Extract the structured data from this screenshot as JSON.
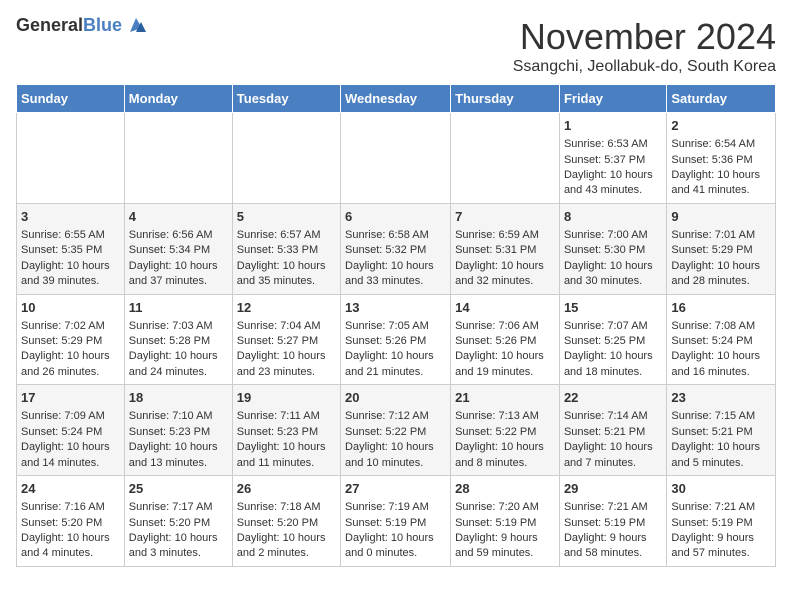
{
  "app": {
    "logo_line1": "General",
    "logo_line2": "Blue"
  },
  "header": {
    "title": "November 2024",
    "subtitle": "Ssangchi, Jeollabuk-do, South Korea"
  },
  "calendar": {
    "days_of_week": [
      "Sunday",
      "Monday",
      "Tuesday",
      "Wednesday",
      "Thursday",
      "Friday",
      "Saturday"
    ],
    "weeks": [
      [
        {
          "day": "",
          "content": ""
        },
        {
          "day": "",
          "content": ""
        },
        {
          "day": "",
          "content": ""
        },
        {
          "day": "",
          "content": ""
        },
        {
          "day": "",
          "content": ""
        },
        {
          "day": "1",
          "content": "Sunrise: 6:53 AM\nSunset: 5:37 PM\nDaylight: 10 hours and 43 minutes."
        },
        {
          "day": "2",
          "content": "Sunrise: 6:54 AM\nSunset: 5:36 PM\nDaylight: 10 hours and 41 minutes."
        }
      ],
      [
        {
          "day": "3",
          "content": "Sunrise: 6:55 AM\nSunset: 5:35 PM\nDaylight: 10 hours and 39 minutes."
        },
        {
          "day": "4",
          "content": "Sunrise: 6:56 AM\nSunset: 5:34 PM\nDaylight: 10 hours and 37 minutes."
        },
        {
          "day": "5",
          "content": "Sunrise: 6:57 AM\nSunset: 5:33 PM\nDaylight: 10 hours and 35 minutes."
        },
        {
          "day": "6",
          "content": "Sunrise: 6:58 AM\nSunset: 5:32 PM\nDaylight: 10 hours and 33 minutes."
        },
        {
          "day": "7",
          "content": "Sunrise: 6:59 AM\nSunset: 5:31 PM\nDaylight: 10 hours and 32 minutes."
        },
        {
          "day": "8",
          "content": "Sunrise: 7:00 AM\nSunset: 5:30 PM\nDaylight: 10 hours and 30 minutes."
        },
        {
          "day": "9",
          "content": "Sunrise: 7:01 AM\nSunset: 5:29 PM\nDaylight: 10 hours and 28 minutes."
        }
      ],
      [
        {
          "day": "10",
          "content": "Sunrise: 7:02 AM\nSunset: 5:29 PM\nDaylight: 10 hours and 26 minutes."
        },
        {
          "day": "11",
          "content": "Sunrise: 7:03 AM\nSunset: 5:28 PM\nDaylight: 10 hours and 24 minutes."
        },
        {
          "day": "12",
          "content": "Sunrise: 7:04 AM\nSunset: 5:27 PM\nDaylight: 10 hours and 23 minutes."
        },
        {
          "day": "13",
          "content": "Sunrise: 7:05 AM\nSunset: 5:26 PM\nDaylight: 10 hours and 21 minutes."
        },
        {
          "day": "14",
          "content": "Sunrise: 7:06 AM\nSunset: 5:26 PM\nDaylight: 10 hours and 19 minutes."
        },
        {
          "day": "15",
          "content": "Sunrise: 7:07 AM\nSunset: 5:25 PM\nDaylight: 10 hours and 18 minutes."
        },
        {
          "day": "16",
          "content": "Sunrise: 7:08 AM\nSunset: 5:24 PM\nDaylight: 10 hours and 16 minutes."
        }
      ],
      [
        {
          "day": "17",
          "content": "Sunrise: 7:09 AM\nSunset: 5:24 PM\nDaylight: 10 hours and 14 minutes."
        },
        {
          "day": "18",
          "content": "Sunrise: 7:10 AM\nSunset: 5:23 PM\nDaylight: 10 hours and 13 minutes."
        },
        {
          "day": "19",
          "content": "Sunrise: 7:11 AM\nSunset: 5:23 PM\nDaylight: 10 hours and 11 minutes."
        },
        {
          "day": "20",
          "content": "Sunrise: 7:12 AM\nSunset: 5:22 PM\nDaylight: 10 hours and 10 minutes."
        },
        {
          "day": "21",
          "content": "Sunrise: 7:13 AM\nSunset: 5:22 PM\nDaylight: 10 hours and 8 minutes."
        },
        {
          "day": "22",
          "content": "Sunrise: 7:14 AM\nSunset: 5:21 PM\nDaylight: 10 hours and 7 minutes."
        },
        {
          "day": "23",
          "content": "Sunrise: 7:15 AM\nSunset: 5:21 PM\nDaylight: 10 hours and 5 minutes."
        }
      ],
      [
        {
          "day": "24",
          "content": "Sunrise: 7:16 AM\nSunset: 5:20 PM\nDaylight: 10 hours and 4 minutes."
        },
        {
          "day": "25",
          "content": "Sunrise: 7:17 AM\nSunset: 5:20 PM\nDaylight: 10 hours and 3 minutes."
        },
        {
          "day": "26",
          "content": "Sunrise: 7:18 AM\nSunset: 5:20 PM\nDaylight: 10 hours and 2 minutes."
        },
        {
          "day": "27",
          "content": "Sunrise: 7:19 AM\nSunset: 5:19 PM\nDaylight: 10 hours and 0 minutes."
        },
        {
          "day": "28",
          "content": "Sunrise: 7:20 AM\nSunset: 5:19 PM\nDaylight: 9 hours and 59 minutes."
        },
        {
          "day": "29",
          "content": "Sunrise: 7:21 AM\nSunset: 5:19 PM\nDaylight: 9 hours and 58 minutes."
        },
        {
          "day": "30",
          "content": "Sunrise: 7:21 AM\nSunset: 5:19 PM\nDaylight: 9 hours and 57 minutes."
        }
      ]
    ]
  }
}
